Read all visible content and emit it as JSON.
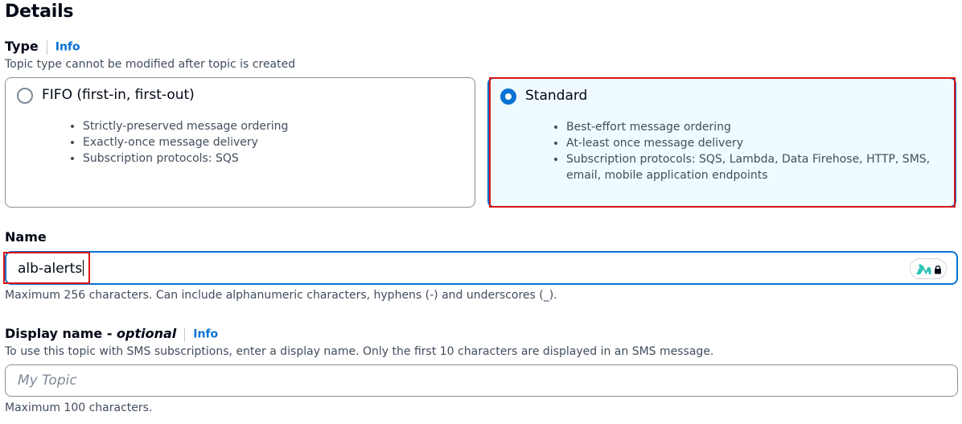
{
  "section": {
    "title": "Details"
  },
  "type_field": {
    "label": "Type",
    "info": "Info",
    "description": "Topic type cannot be modified after topic is created",
    "options": [
      {
        "title": "FIFO (first-in, first-out)",
        "selected": false,
        "bullets": [
          "Strictly-preserved message ordering",
          "Exactly-once message delivery",
          "Subscription protocols: SQS"
        ]
      },
      {
        "title": "Standard",
        "selected": true,
        "bullets": [
          "Best-effort message ordering",
          "At-least once message delivery",
          "Subscription protocols: SQS, Lambda, Data Firehose, HTTP, SMS, email, mobile application endpoints"
        ]
      }
    ]
  },
  "name_field": {
    "label": "Name",
    "value": "alb-alerts",
    "constraint": "Maximum 256 characters. Can include alphanumeric characters, hyphens (-) and underscores (_)."
  },
  "display_name_field": {
    "label": "Display name - ",
    "label_optional": "optional",
    "info": "Info",
    "description": "To use this topic with SMS subscriptions, enter a display name. Only the first 10 characters are displayed in an SMS message.",
    "placeholder": "My Topic",
    "constraint": "Maximum 100 characters."
  },
  "colors": {
    "accent": "#0972d3",
    "selected_bg": "#f0fbff",
    "highlight": "#d91515",
    "ext_icon": "#2ec4b6"
  },
  "icons": {
    "radio": "radio-icon",
    "extension": "password-manager-icon",
    "lock": "lock-icon"
  }
}
